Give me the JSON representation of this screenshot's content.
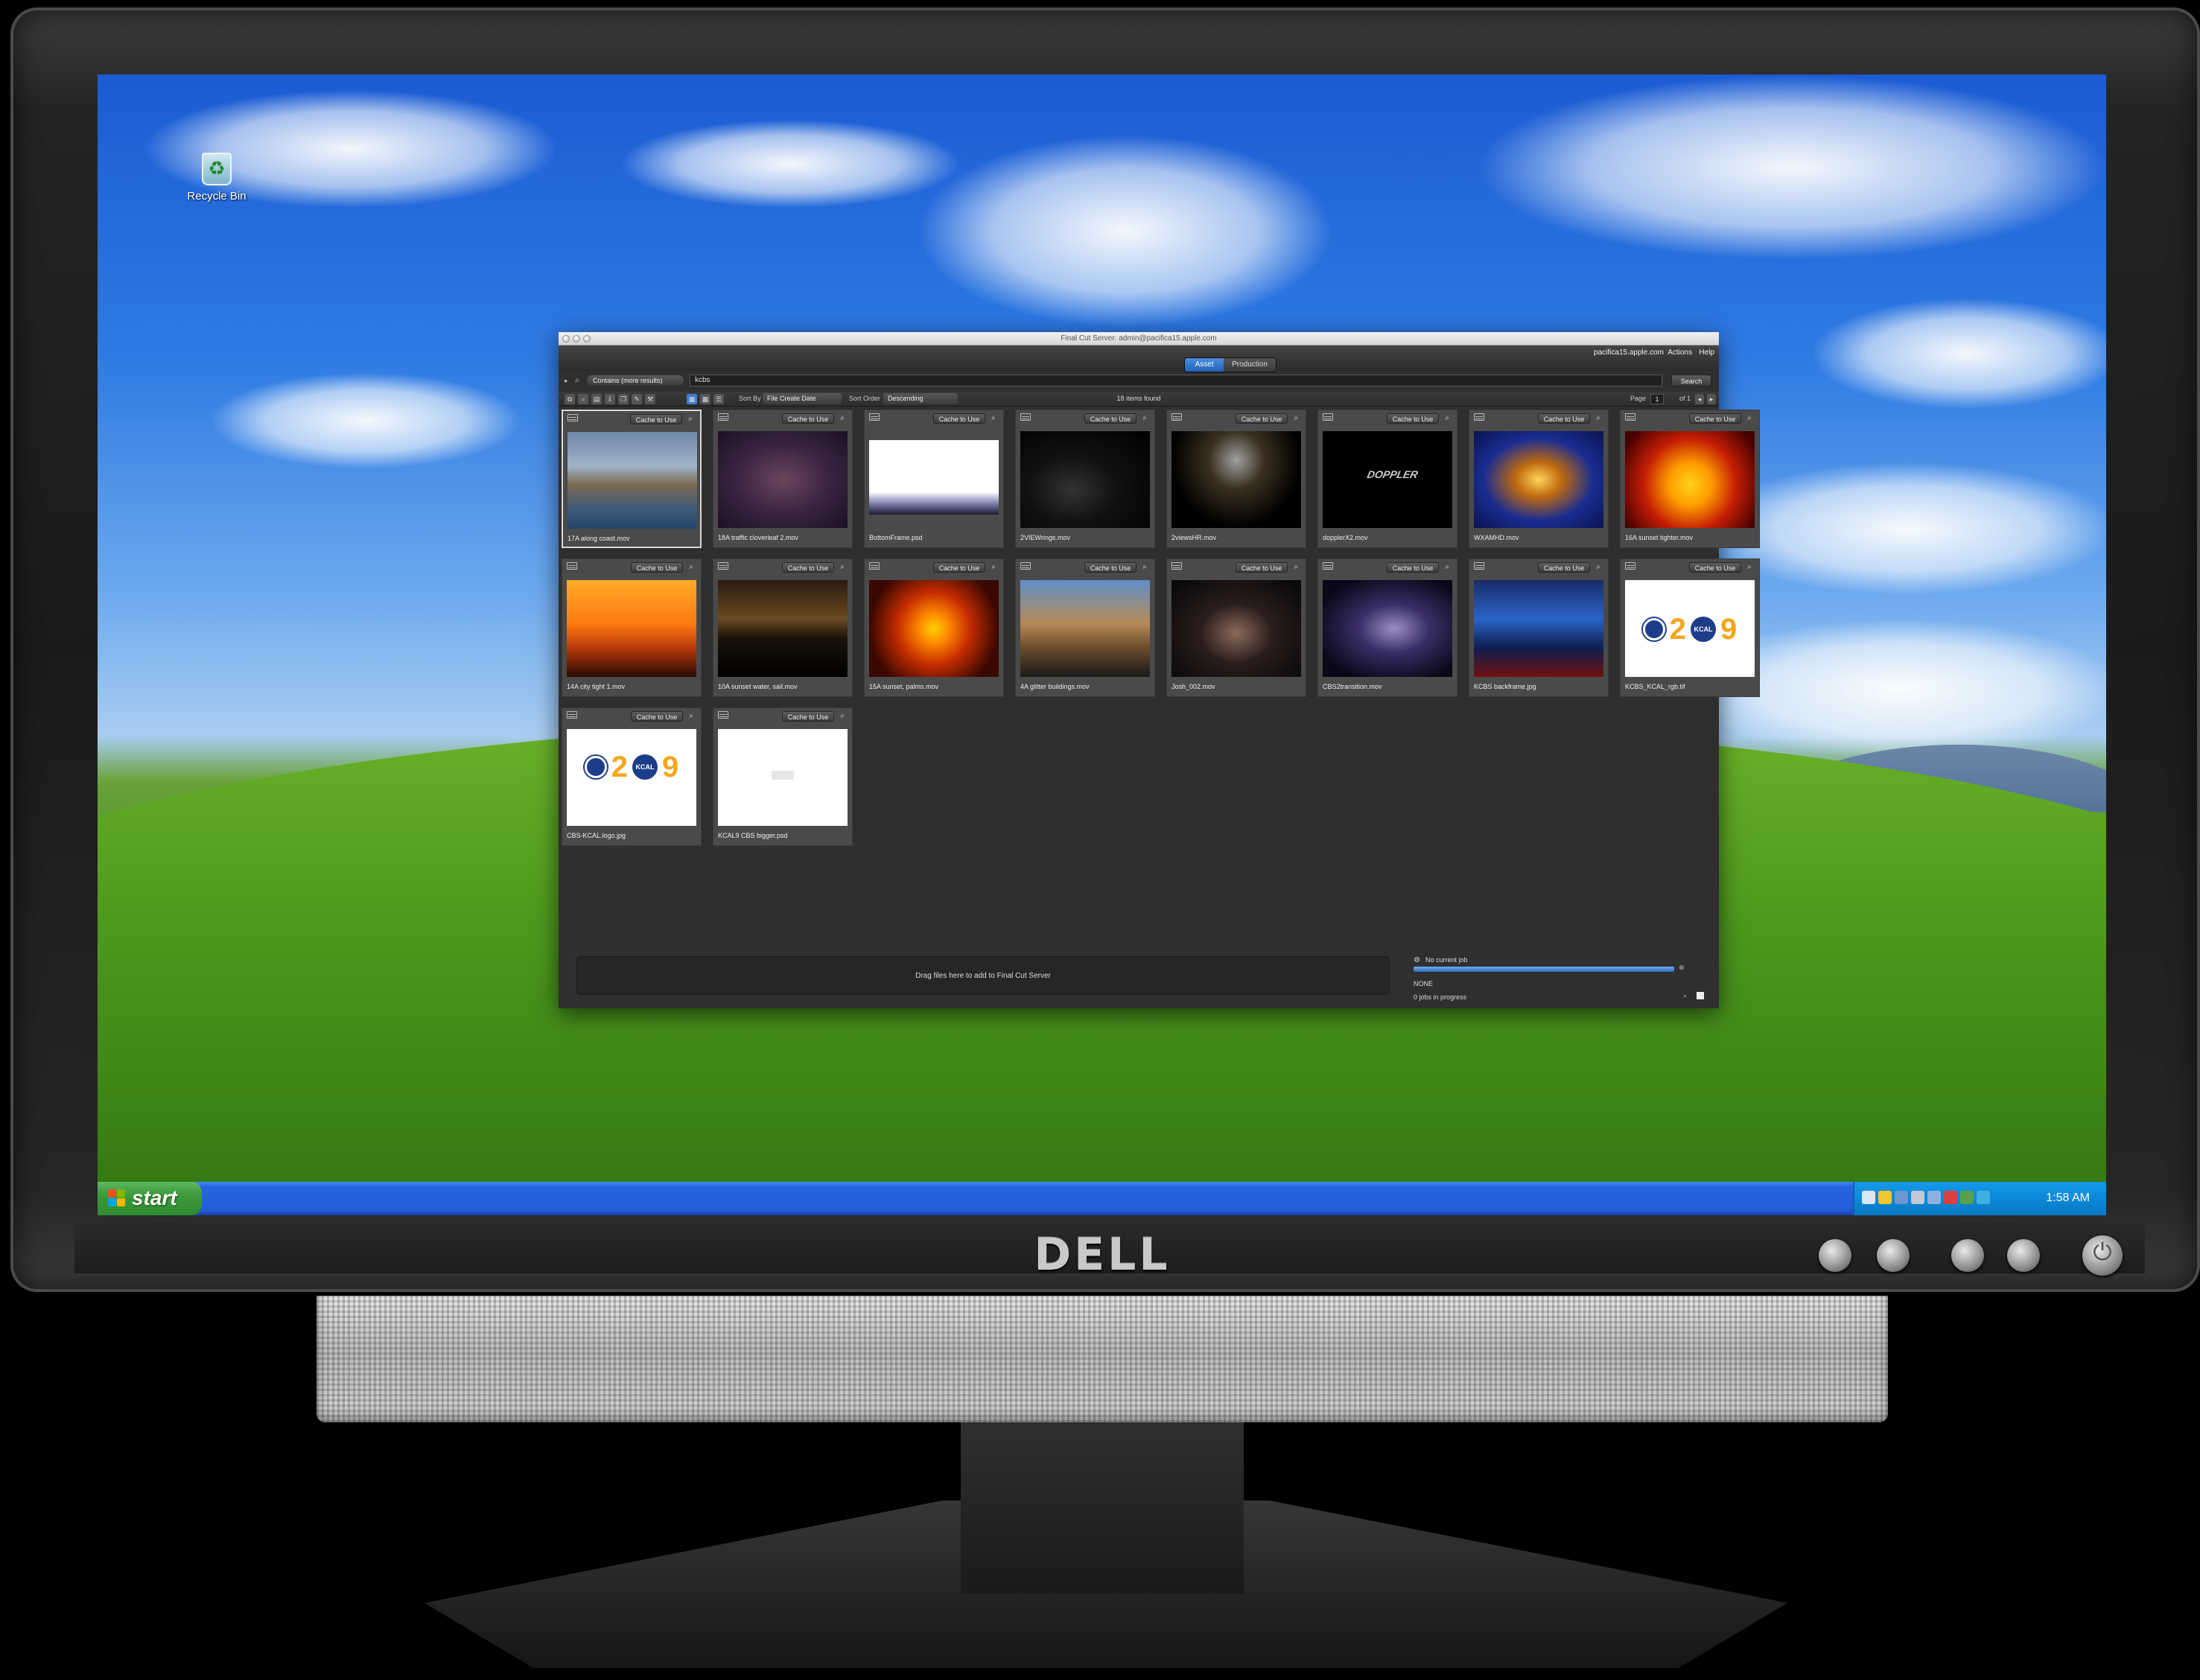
{
  "brand": {
    "logo_text": "DELL"
  },
  "desktop": {
    "icons": [
      {
        "label": "Recycle Bin",
        "icon": "recycle-bin-icon"
      }
    ],
    "taskbar": {
      "start_label": "start",
      "clock": "1:58 AM"
    }
  },
  "window": {
    "title": "Final Cut Server: admin@pacifica15.apple.com",
    "server": "pacifica15.apple.com",
    "menus": {
      "actions": "Actions",
      "help": "Help"
    },
    "tabs": [
      {
        "label": "Asset",
        "active": true
      },
      {
        "label": "Production",
        "active": false
      }
    ],
    "search": {
      "mode": "Contains (more results)",
      "query": "kcbs",
      "button": "Search"
    },
    "toolbar": {
      "sort_by_label": "Sort By",
      "sort_by_value": "File Create Date",
      "sort_order_label": "Sort Order",
      "sort_order_value": "Descending",
      "items_found": "18 items found",
      "page_label": "Page",
      "page_value": "1",
      "page_of": "of 1"
    },
    "cache_label": "Cache to Use",
    "assets": [
      {
        "name": "17A along coast.mov",
        "kind": "video"
      },
      {
        "name": "18A traffic cloverleaf 2.mov",
        "kind": "video"
      },
      {
        "name": "BottomFrame.psd",
        "kind": "image"
      },
      {
        "name": "2VIEWrings.mov",
        "kind": "video"
      },
      {
        "name": "2viewsHR.mov",
        "kind": "video"
      },
      {
        "name": "dopplerX2.mov",
        "kind": "video"
      },
      {
        "name": "WXAMHD.mov",
        "kind": "video"
      },
      {
        "name": "16A sunset tighter.mov",
        "kind": "video"
      },
      {
        "name": "14A city tight 1.mov",
        "kind": "video"
      },
      {
        "name": "10A sunset water, sail.mov",
        "kind": "video"
      },
      {
        "name": "15A sunset, palms.mov",
        "kind": "video"
      },
      {
        "name": "4A glitter buildings.mov",
        "kind": "video"
      },
      {
        "name": "Josh_002.mov",
        "kind": "video"
      },
      {
        "name": "CBS2transition.mov",
        "kind": "video"
      },
      {
        "name": "KCBS backframe.jpg",
        "kind": "image"
      },
      {
        "name": "KCBS_KCAL_rgb.tif",
        "kind": "image"
      },
      {
        "name": "CBS-KCAL.logo.jpg",
        "kind": "image"
      },
      {
        "name": "KCAL9 CBS bigger.psd",
        "kind": "image"
      }
    ],
    "thumb_text": {
      "doppler": "DOPPLER",
      "logo_2": "2",
      "logo_kcal": "KCAL",
      "logo_9": "9"
    },
    "drop_zone": "Drag files here to add to Final Cut Server",
    "jobs": {
      "title": "No current job",
      "state": "NONE",
      "count": "0 jobs in progress"
    }
  }
}
